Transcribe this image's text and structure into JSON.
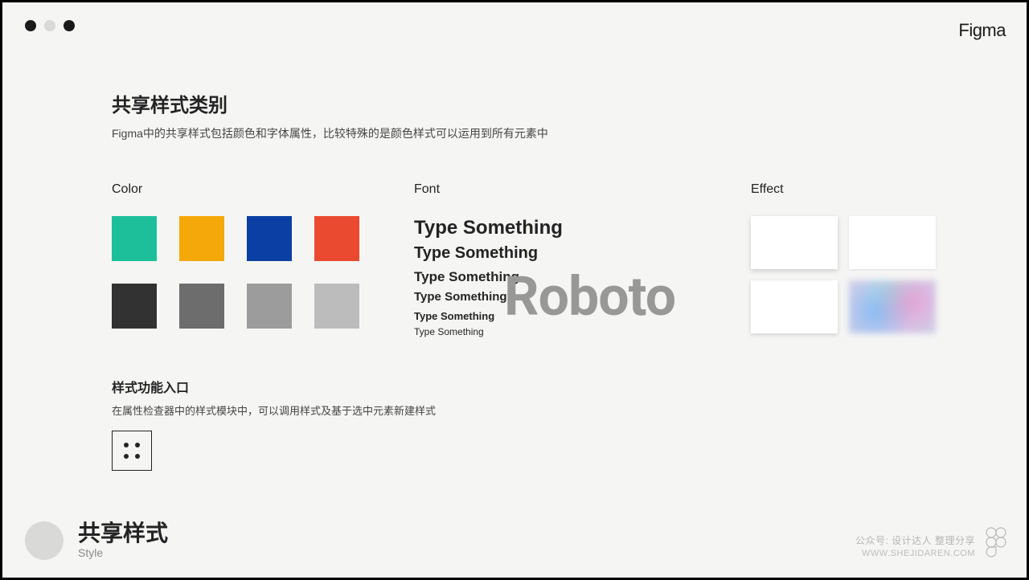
{
  "brand": "Figma",
  "header": {
    "title": "共享样式类别",
    "subtitle": "Figma中的共享样式包括颜色和字体属性，比较特殊的是颜色样式可以运用到所有元素中"
  },
  "columns": {
    "color": {
      "title": "Color",
      "swatches": [
        "#1dbf9a",
        "#f5a80a",
        "#0b3fa3",
        "#ea4a2f",
        "#323232",
        "#6d6d6d",
        "#9c9c9c",
        "#bcbcbc"
      ]
    },
    "font": {
      "title": "Font",
      "big_label": "Roboto",
      "samples": [
        "Type Something",
        "Type Something",
        "Type Something",
        "Type Something",
        "Type Something",
        "Type Something"
      ]
    },
    "effect": {
      "title": "Effect"
    }
  },
  "section2": {
    "title": "样式功能入口",
    "subtitle": "在属性检查器中的样式模块中，可以调用样式及基于选中元素新建样式"
  },
  "footer": {
    "title": "共享样式",
    "subtitle": "Style"
  },
  "watermark": {
    "line1": "公众号: 设计达人  整理分享",
    "line2": "WWW.SHEJIDAREN.COM"
  }
}
